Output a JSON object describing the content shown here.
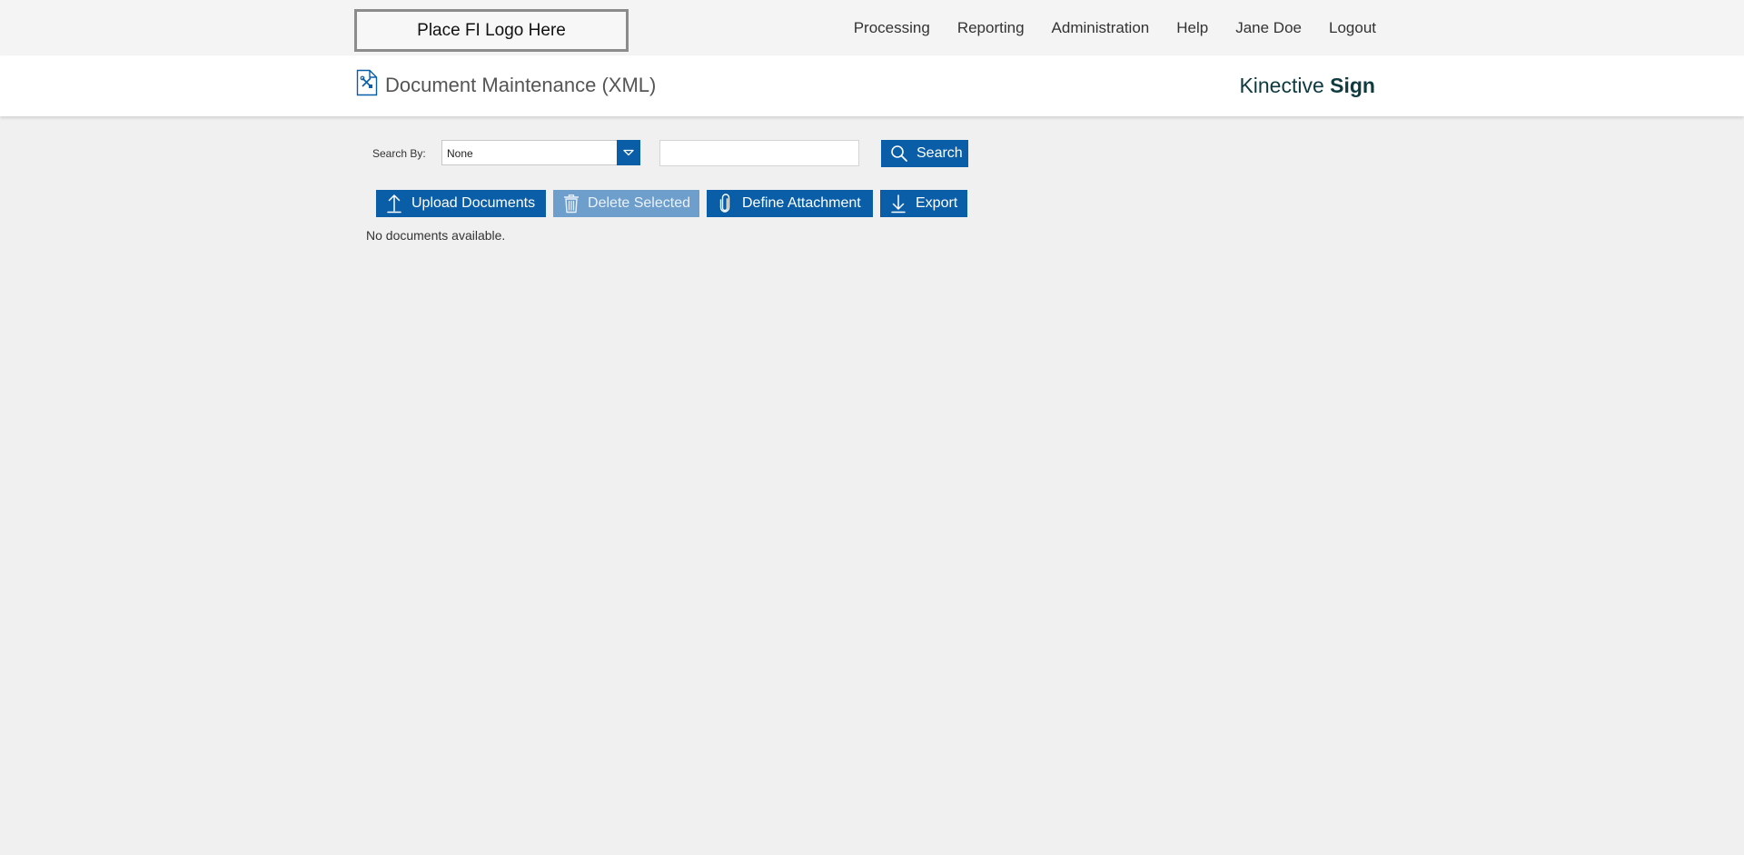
{
  "header": {
    "logo_text": "Place FI Logo Here",
    "nav": [
      "Processing",
      "Reporting",
      "Administration",
      "Help",
      "Jane Doe",
      "Logout"
    ]
  },
  "titlebar": {
    "page_icon": "document-tools-icon",
    "page_title": "Document Maintenance (XML)",
    "brand_light": "Kinective",
    "brand_bold": "Sign"
  },
  "search": {
    "label": "Search By:",
    "selected": "None",
    "query": "",
    "placeholder": "",
    "button_label": "Search",
    "button_icon": "search-icon"
  },
  "toolbar": {
    "upload_label": "Upload Documents",
    "upload_icon": "upload-icon",
    "delete_label": "Delete Selected",
    "delete_icon": "trash-icon",
    "define_label": "Define Attachment",
    "define_icon": "paperclip-icon",
    "export_label": "Export",
    "export_icon": "download-icon"
  },
  "content": {
    "empty_message": "No documents available."
  },
  "colors": {
    "accent": "#0a5ea8",
    "accent_disabled": "#6e9fcc",
    "brand_text": "#0e3a40",
    "page_bg": "#f0f0f0"
  }
}
